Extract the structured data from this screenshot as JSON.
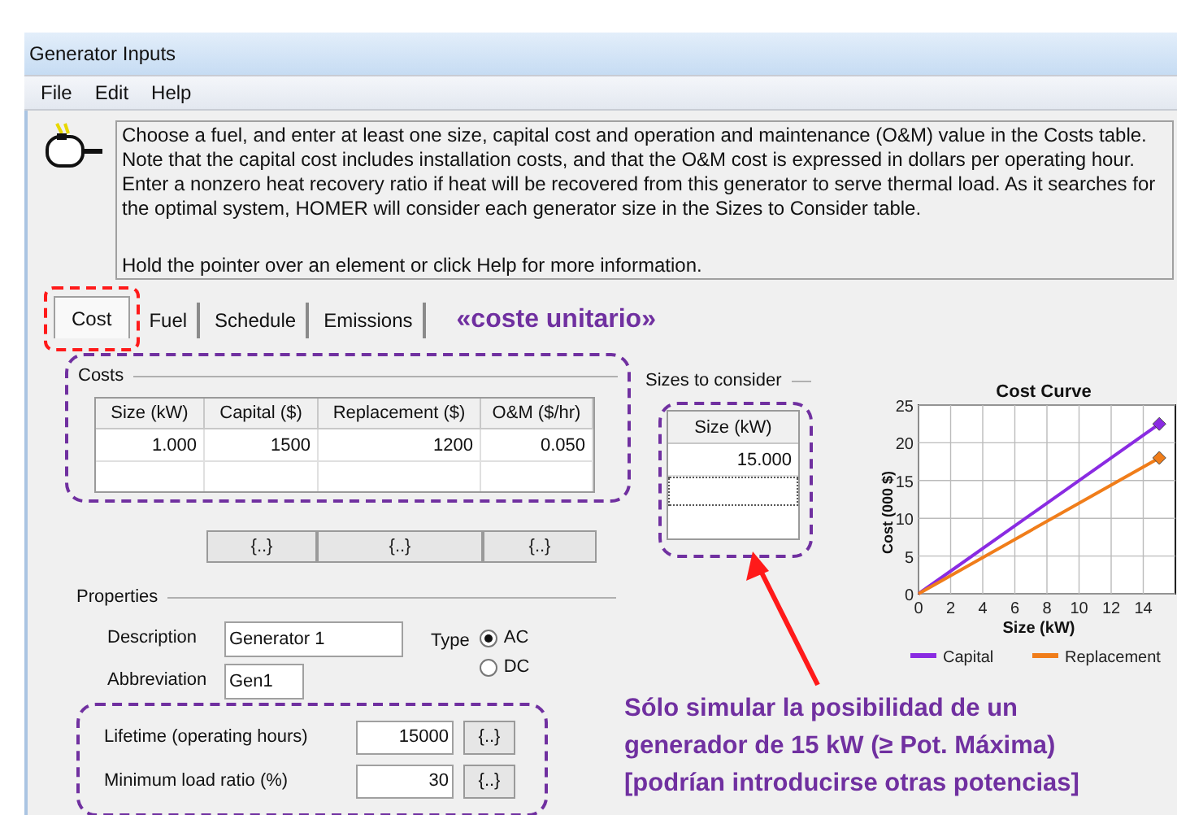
{
  "window": {
    "title": "Generator Inputs"
  },
  "menu": [
    "File",
    "Edit",
    "Help"
  ],
  "info": {
    "text": "Choose a fuel, and enter at least one size, capital cost and operation and maintenance (O&M) value in the Costs table. Note that the capital cost includes installation costs, and that the O&M cost is expressed in dollars per operating hour. Enter a nonzero heat recovery ratio if heat will be recovered from this generator to serve thermal load. As it searches for the optimal system, HOMER will consider each generator size in the Sizes to Consider table.",
    "hint": "Hold the pointer over an element or click Help for more information."
  },
  "tabs": [
    {
      "label": "Cost",
      "selected": true
    },
    {
      "label": "Fuel",
      "selected": false
    },
    {
      "label": "Schedule",
      "selected": false
    },
    {
      "label": "Emissions",
      "selected": false
    }
  ],
  "tab_note": "«coste unitario»",
  "costs": {
    "title": "Costs",
    "columns": [
      "Size (kW)",
      "Capital ($)",
      "Replacement ($)",
      "O&M ($/hr)"
    ],
    "rows": [
      [
        "1.000",
        "1500",
        "1200",
        "0.050"
      ]
    ],
    "buttons": [
      "{..}",
      "{..}",
      "{..}"
    ]
  },
  "sizes": {
    "title": "Sizes to consider",
    "column": "Size (kW)",
    "rows": [
      "15.000"
    ]
  },
  "properties": {
    "title": "Properties",
    "description": {
      "label": "Description",
      "value": "Generator 1"
    },
    "abbreviation": {
      "label": "Abbreviation",
      "value": "Gen1"
    },
    "type": {
      "label": "Type",
      "options": [
        {
          "label": "AC",
          "selected": true
        },
        {
          "label": "DC",
          "selected": false
        }
      ]
    },
    "params": [
      {
        "label": "Lifetime (operating hours)",
        "value": "15000",
        "button": "{..}"
      },
      {
        "label": "Minimum load ratio (%)",
        "value": "30",
        "button": "{..}"
      }
    ]
  },
  "note_lines": [
    "Sólo simular la posibilidad de un",
    "generador de 15 kW  (≥ Pot. Máxima)",
    "[podrían introducirse otras potencias]"
  ],
  "chart": {
    "chart_data": {
      "type": "line",
      "title": "Cost Curve",
      "xlabel": "Size (kW)",
      "ylabel": "Cost (000 $)",
      "x": [
        0,
        15
      ],
      "series": [
        {
          "name": "Capital",
          "color": "#8a2be2",
          "values": [
            0,
            22.5
          ]
        },
        {
          "name": "Replacement",
          "color": "#f07d1a",
          "values": [
            0,
            18
          ]
        }
      ],
      "grid": true,
      "legend": true,
      "xlim": [
        0,
        16
      ],
      "ylim": [
        0,
        25
      ],
      "xticks": [
        0,
        2,
        4,
        6,
        8,
        10,
        12,
        14
      ],
      "yticks": [
        0,
        5,
        10,
        15,
        20,
        25
      ]
    }
  }
}
